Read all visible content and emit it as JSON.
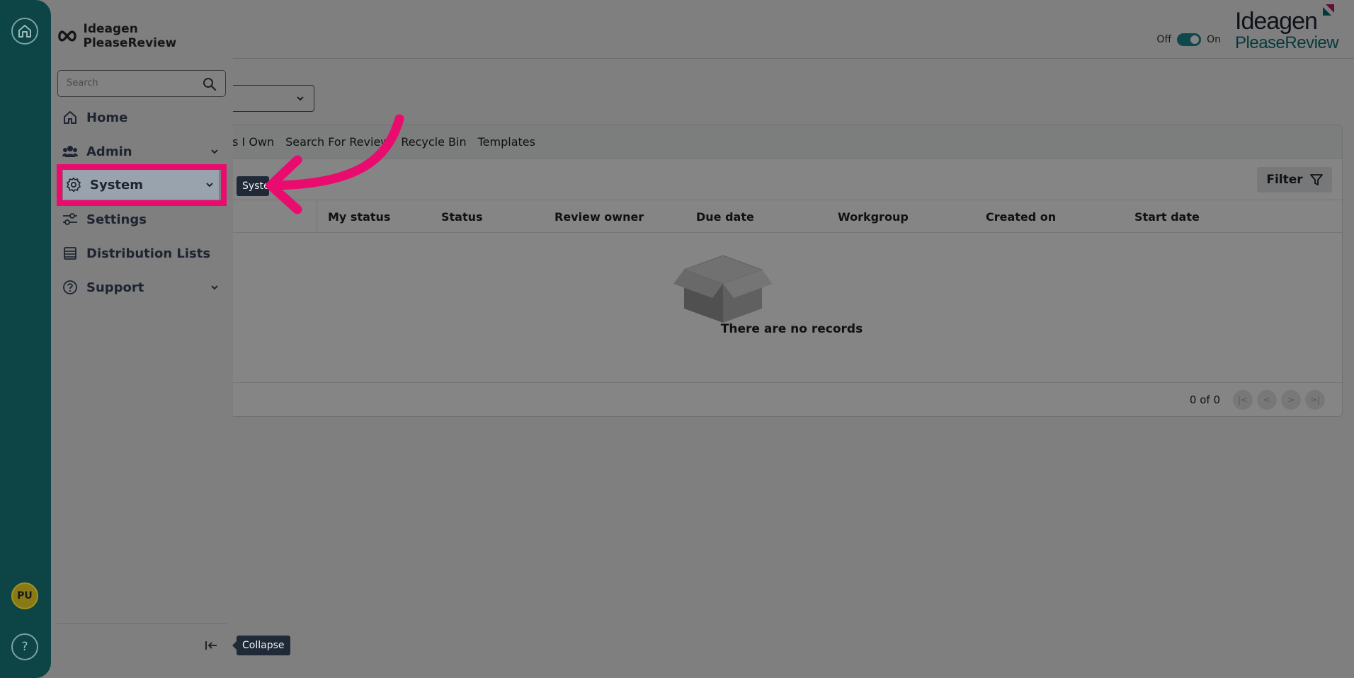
{
  "header": {
    "toggle_off": "Off",
    "toggle_on": "On",
    "brand_line1": "Ideagen",
    "brand_line2": "PleaseReview"
  },
  "tabs": [
    "ws I Own",
    "Search For Review",
    "Recycle Bin",
    "Templates"
  ],
  "filter": {
    "label": "Filter"
  },
  "table": {
    "columns": [
      "My status",
      "Status",
      "Review owner",
      "Due date",
      "Workgroup",
      "Created on",
      "Start date"
    ],
    "empty_message": "There are no records",
    "page_count": "0 of 0"
  },
  "rail": {
    "avatar_initials": "PU",
    "help_glyph": "?"
  },
  "menu": {
    "brand": "Ideagen PleaseReview",
    "search_placeholder": "Search",
    "items": [
      {
        "label": "Home",
        "icon": "home-icon"
      },
      {
        "label": "Admin",
        "icon": "users-icon"
      },
      {
        "label": "System",
        "icon": "gear-icon"
      },
      {
        "label": "Settings",
        "icon": "sliders-icon"
      },
      {
        "label": "Distribution Lists",
        "icon": "list-icon"
      },
      {
        "label": "Support",
        "icon": "help-circle-icon"
      }
    ],
    "tooltip_system": "System",
    "tooltip_collapse": "Collapse"
  },
  "colors": {
    "rail": "#0d4446",
    "highlight": "#ea0b6f",
    "accent": "#1e8a93"
  }
}
